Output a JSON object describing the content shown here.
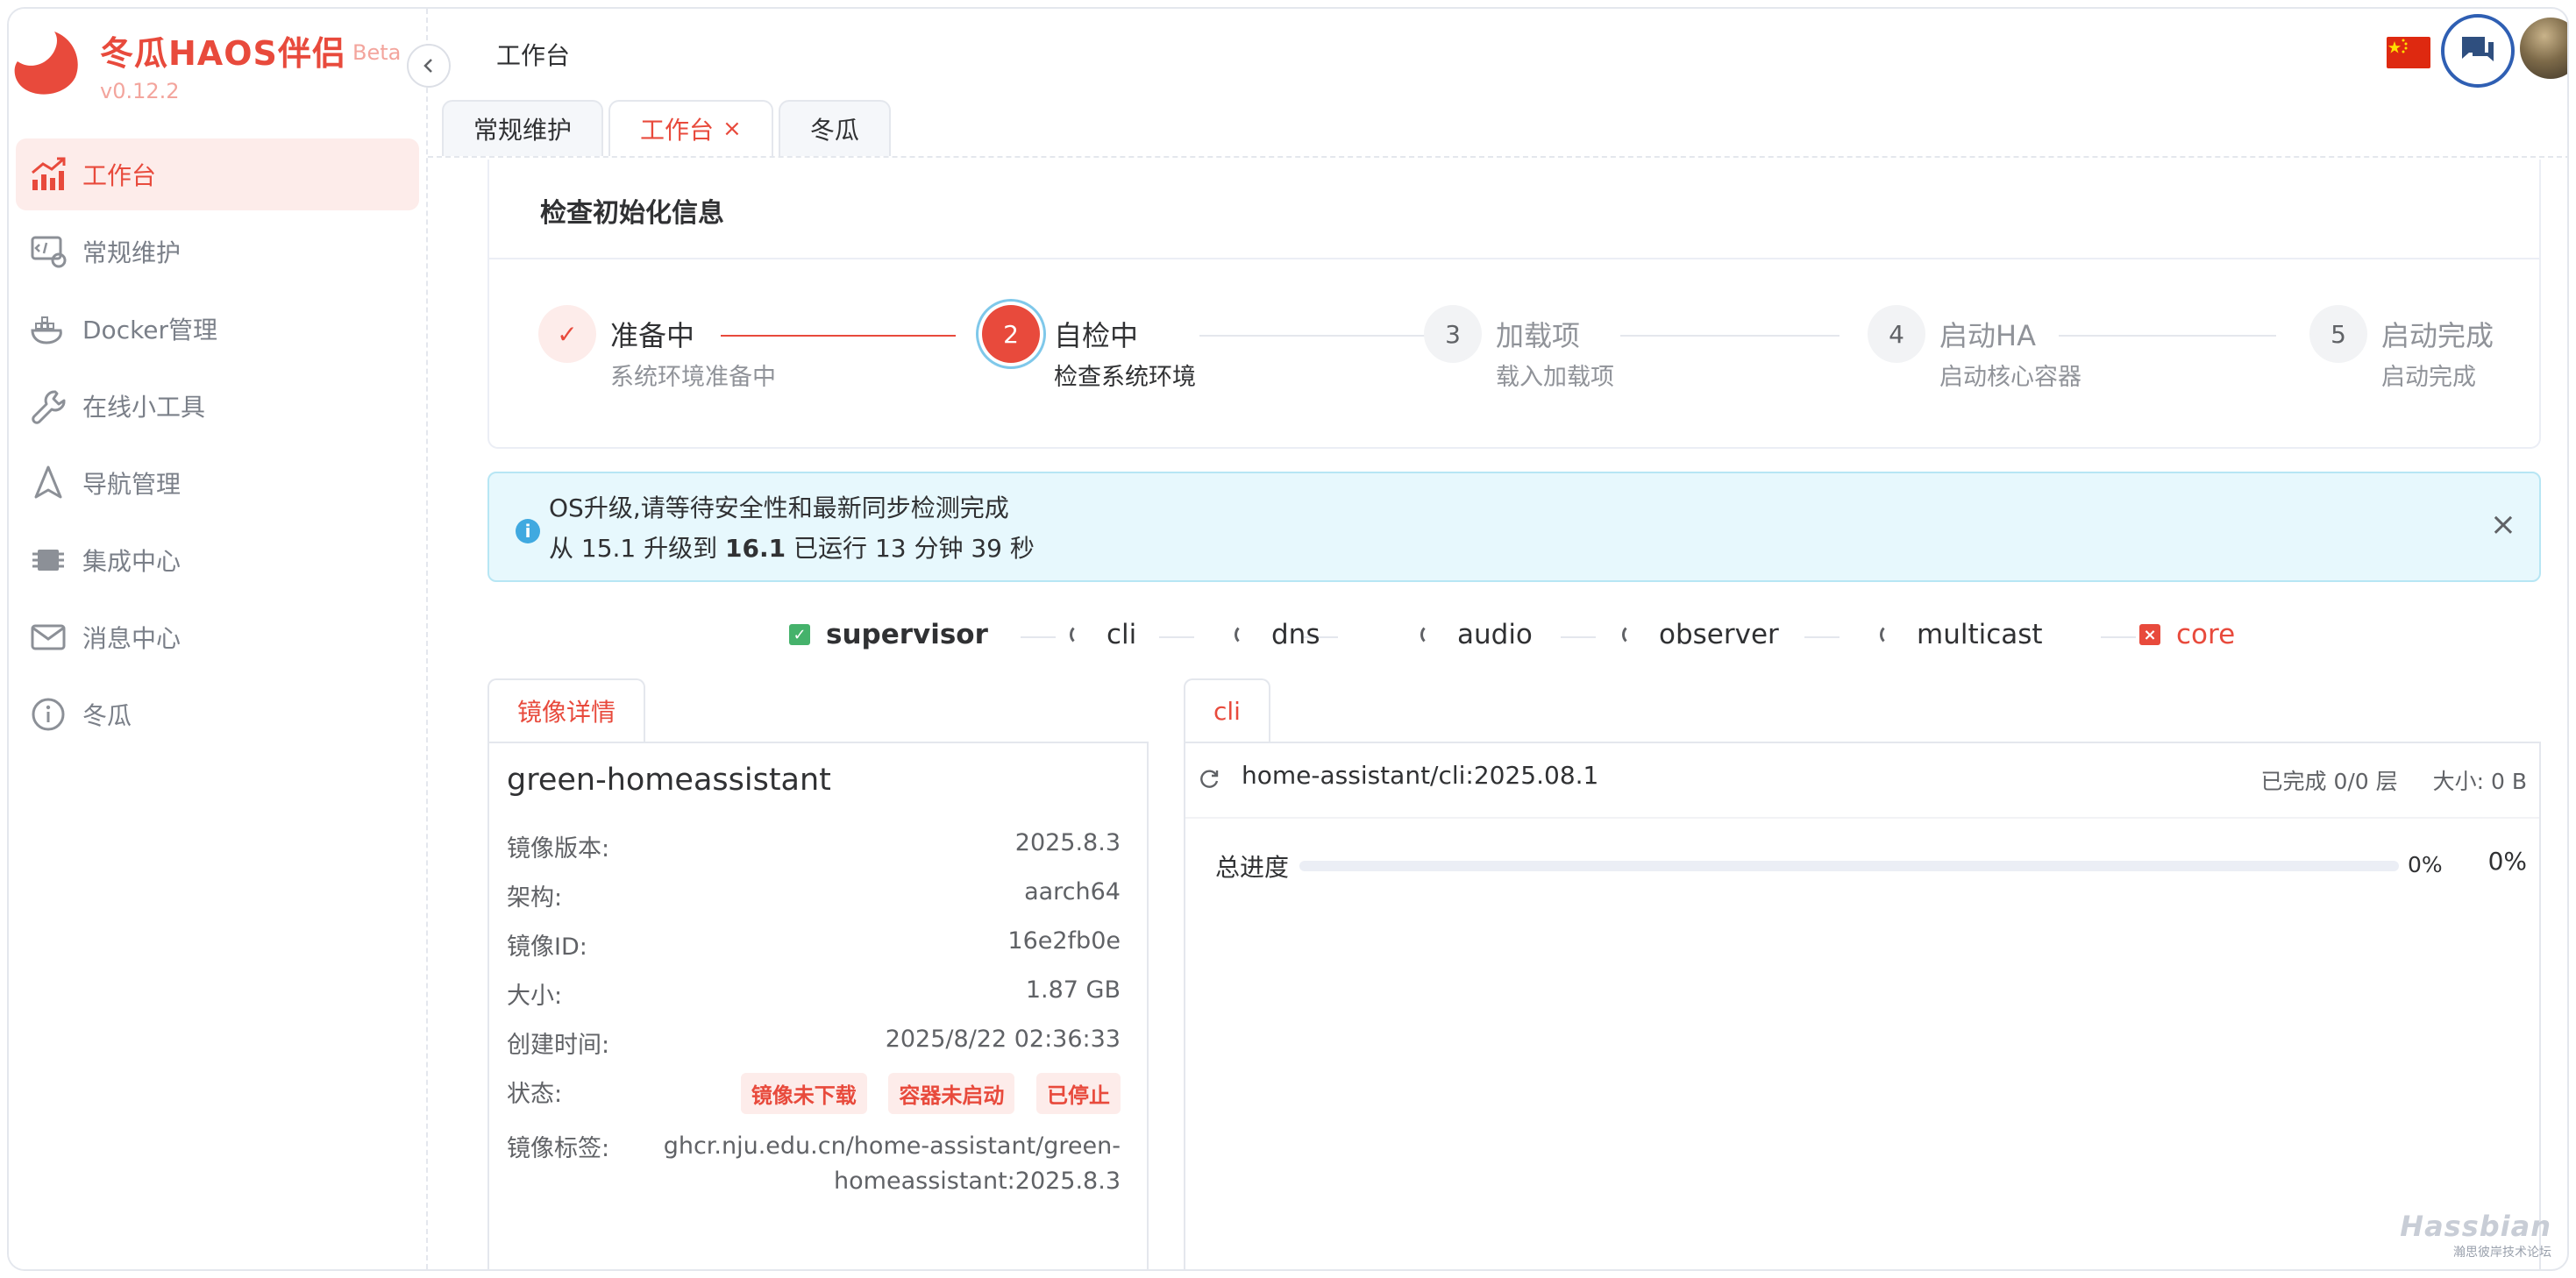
{
  "brand": {
    "title": "冬瓜HAOS伴侣",
    "beta": "Beta",
    "version": "v0.12.2"
  },
  "sidebar": {
    "items": [
      {
        "label": "工作台",
        "icon": "chart-up-icon",
        "active": true
      },
      {
        "label": "常规维护",
        "icon": "maintenance-icon"
      },
      {
        "label": "Docker管理",
        "icon": "docker-icon"
      },
      {
        "label": "在线小工具",
        "icon": "wrench-icon"
      },
      {
        "label": "导航管理",
        "icon": "navigation-icon"
      },
      {
        "label": "集成中心",
        "icon": "chip-icon"
      },
      {
        "label": "消息中心",
        "icon": "mail-icon"
      },
      {
        "label": "冬瓜",
        "icon": "info-icon"
      }
    ]
  },
  "header": {
    "title": "工作台"
  },
  "tabs": [
    {
      "label": "常规维护"
    },
    {
      "label": "工作台",
      "active": true,
      "closable": "×"
    },
    {
      "label": "冬瓜"
    }
  ],
  "steps_card": {
    "title": "检查初始化信息",
    "steps": [
      {
        "num": "✓",
        "title": "准备中",
        "desc": "系统环境准备中",
        "state": "done"
      },
      {
        "num": "2",
        "title": "自检中",
        "desc": "检查系统环境",
        "state": "active"
      },
      {
        "num": "3",
        "title": "加载项",
        "desc": "载入加载项",
        "state": "wait"
      },
      {
        "num": "4",
        "title": "启动HA",
        "desc": "启动核心容器",
        "state": "wait"
      },
      {
        "num": "5",
        "title": "启动完成",
        "desc": "启动完成",
        "state": "wait"
      }
    ]
  },
  "alert": {
    "line1": "OS升级,请等待安全性和最新同步检测完成",
    "line2_prefix": "从 15.1 升级到 ",
    "line2_bold": "16.1",
    "line2_suffix": " 已运行 13 分钟 39 秒",
    "close": "×"
  },
  "services": [
    {
      "name": "supervisor",
      "state": "ok",
      "mark": "✓"
    },
    {
      "name": "cli",
      "state": "loading",
      "mark": ""
    },
    {
      "name": "dns",
      "state": "loading",
      "mark": ""
    },
    {
      "name": "audio",
      "state": "loading",
      "mark": ""
    },
    {
      "name": "observer",
      "state": "loading",
      "mark": ""
    },
    {
      "name": "multicast",
      "state": "loading",
      "mark": ""
    },
    {
      "name": "core",
      "state": "error",
      "mark": "×"
    }
  ],
  "image_details": {
    "tab": "镜像详情",
    "name": "green-homeassistant",
    "rows": [
      {
        "key": "镜像版本:",
        "value": "2025.8.3"
      },
      {
        "key": "架构:",
        "value": "aarch64"
      },
      {
        "key": "镜像ID:",
        "value": "16e2fb0e"
      },
      {
        "key": "大小:",
        "value": "1.87 GB"
      },
      {
        "key": "创建时间:",
        "value": "2025/8/22 02:36:33"
      }
    ],
    "status_key": "状态:",
    "status_badges": [
      "镜像未下载",
      "容器未启动",
      "已停止"
    ],
    "tag_key": "镜像标签:",
    "tag_value": "ghcr.nju.edu.cn/home-assistant/green-homeassistant:2025.8.3"
  },
  "pull_panel": {
    "tab": "cli",
    "image": "home-assistant/cli:2025.08.1",
    "layers": "已完成 0/0 层",
    "size": "大小: 0 B",
    "progress_label": "总进度",
    "progress": 0,
    "progress_pct_inline": "0%",
    "progress_pct": "0%"
  },
  "watermark": {
    "line1": "Hassbian",
    "line2": "瀚思彼岸技术论坛"
  },
  "colors": {
    "accent": "#e84a3c",
    "info": "#40a9e0",
    "success": "#45b26b"
  }
}
